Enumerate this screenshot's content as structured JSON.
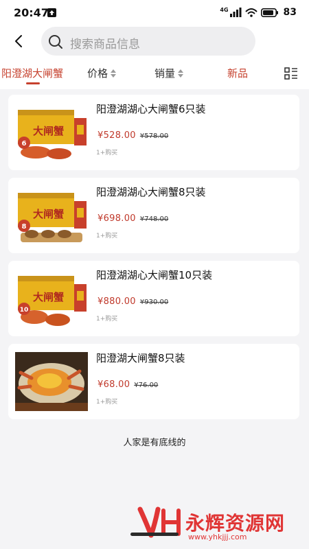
{
  "status": {
    "time": "20:47",
    "network": "4G",
    "battery": "83"
  },
  "search": {
    "placeholder": "搜索商品信息"
  },
  "filters": {
    "keyword": "阳澄湖大闸蟹",
    "price": "价格",
    "sales": "销量",
    "new": "新品"
  },
  "products": [
    {
      "title": "阳澄湖湖心大闸蟹6只装",
      "price": "¥528.00",
      "old_price": "¥578.00",
      "sold": "1+购买",
      "badge": "6"
    },
    {
      "title": "阳澄湖湖心大闸蟹8只装",
      "price": "¥698.00",
      "old_price": "¥748.00",
      "sold": "1+购买",
      "badge": "8"
    },
    {
      "title": "阳澄湖湖心大闸蟹10只装",
      "price": "¥880.00",
      "old_price": "¥930.00",
      "sold": "1+购买",
      "badge": "10"
    },
    {
      "title": "阳澄湖大闸蟹8只装",
      "price": "¥68.00",
      "old_price": "¥76.00",
      "sold": "1+购买"
    }
  ],
  "footer_note": "人家是有底线的",
  "box_text": "大闸蟹",
  "watermark": {
    "text": "永辉资源网",
    "url": "www.yhkjjj.com"
  },
  "colors": {
    "accent": "#c6412e",
    "price": "#c0392b"
  },
  "icons": [
    "upload-icon",
    "signal-icon",
    "wifi-icon",
    "battery-icon",
    "back-icon",
    "search-icon",
    "sort-icon",
    "layout-toggle-icon"
  ]
}
